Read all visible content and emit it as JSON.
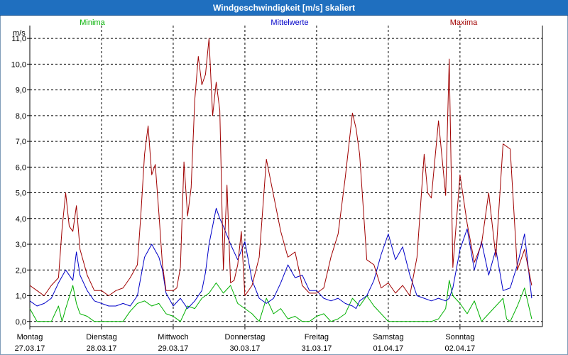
{
  "window": {
    "title": "Windgeschwindigkeit [m/s] skaliert"
  },
  "chart_data": {
    "type": "line",
    "title": "Windgeschwindigkeit [m/s] skaliert",
    "ylabel": "m/s",
    "ylim": [
      -0.2,
      11.5
    ],
    "xlim": [
      0,
      7.15
    ],
    "grid": true,
    "legend_placement": "top",
    "yticks": [
      {
        "value": 0,
        "label": "0,0"
      },
      {
        "value": 1,
        "label": "1,0"
      },
      {
        "value": 2,
        "label": "2,0"
      },
      {
        "value": 3,
        "label": "3,0"
      },
      {
        "value": 4,
        "label": "4,0"
      },
      {
        "value": 5,
        "label": "5,0"
      },
      {
        "value": 6,
        "label": "6,0"
      },
      {
        "value": 7,
        "label": "7,0"
      },
      {
        "value": 8,
        "label": "8,0"
      },
      {
        "value": 9,
        "label": "9,0"
      },
      {
        "value": 10,
        "label": "10,0"
      },
      {
        "value": 11,
        "label": "11,0"
      }
    ],
    "xticks": [
      {
        "value": 0,
        "day": "Montag",
        "date": "27.03.17"
      },
      {
        "value": 1,
        "day": "Dienstag",
        "date": "28.03.17"
      },
      {
        "value": 2,
        "day": "Mittwoch",
        "date": "29.03.17"
      },
      {
        "value": 3,
        "day": "Donnerstag",
        "date": "30.03.17"
      },
      {
        "value": 4,
        "day": "Freitag",
        "date": "31.03.17"
      },
      {
        "value": 5,
        "day": "Samstag",
        "date": "01.04.17"
      },
      {
        "value": 6,
        "day": "Sonntag",
        "date": "02.04.17"
      }
    ],
    "series": [
      {
        "name": "Minima",
        "color": "#00b000",
        "x": [
          0,
          0.1,
          0.2,
          0.3,
          0.4,
          0.45,
          0.5,
          0.6,
          0.65,
          0.7,
          0.8,
          0.9,
          1.0,
          1.1,
          1.2,
          1.3,
          1.4,
          1.5,
          1.6,
          1.7,
          1.8,
          1.9,
          2.0,
          2.1,
          2.2,
          2.3,
          2.4,
          2.5,
          2.6,
          2.7,
          2.8,
          2.9,
          3.0,
          3.1,
          3.2,
          3.3,
          3.4,
          3.5,
          3.6,
          3.7,
          3.8,
          3.9,
          4.0,
          4.1,
          4.2,
          4.3,
          4.4,
          4.5,
          4.6,
          4.7,
          4.8,
          4.9,
          5.0,
          5.1,
          5.2,
          5.3,
          5.4,
          5.5,
          5.6,
          5.7,
          5.8,
          5.85,
          5.9,
          6.0,
          6.1,
          6.2,
          6.3,
          6.4,
          6.5,
          6.6,
          6.65,
          6.7,
          6.8,
          6.9,
          7.0
        ],
        "values": [
          0.5,
          0,
          0,
          0,
          0.6,
          0,
          0.5,
          1.4,
          0.7,
          0.3,
          0.2,
          0,
          0,
          0,
          0,
          0,
          0.4,
          0.7,
          0.8,
          0.6,
          0.7,
          0.3,
          0.2,
          0,
          0.6,
          0.5,
          0.9,
          1.1,
          1.5,
          1.1,
          1.4,
          0.7,
          0.5,
          0.3,
          0,
          0.9,
          0.3,
          0.5,
          0.1,
          0.2,
          0,
          0,
          0.2,
          0.3,
          0,
          0.1,
          0.3,
          0.9,
          0.6,
          1.0,
          0.6,
          0.3,
          0,
          0,
          0,
          0,
          0,
          0,
          0,
          0.1,
          0.5,
          1.6,
          1.0,
          0.7,
          0.3,
          0.8,
          0,
          0.3,
          0.6,
          0.9,
          0.1,
          0,
          0.6,
          1.3,
          0.1
        ]
      },
      {
        "name": "Mittelwerte",
        "color": "#0000c8",
        "x": [
          0,
          0.1,
          0.2,
          0.3,
          0.4,
          0.5,
          0.6,
          0.65,
          0.7,
          0.8,
          0.9,
          1.0,
          1.1,
          1.2,
          1.3,
          1.4,
          1.5,
          1.6,
          1.7,
          1.8,
          1.85,
          1.9,
          2.0,
          2.1,
          2.2,
          2.3,
          2.4,
          2.45,
          2.5,
          2.6,
          2.65,
          2.7,
          2.8,
          2.9,
          3.0,
          3.1,
          3.2,
          3.3,
          3.4,
          3.5,
          3.6,
          3.7,
          3.8,
          3.9,
          4.0,
          4.1,
          4.2,
          4.3,
          4.4,
          4.5,
          4.55,
          4.6,
          4.7,
          4.8,
          4.9,
          5.0,
          5.1,
          5.2,
          5.3,
          5.4,
          5.5,
          5.6,
          5.7,
          5.8,
          5.85,
          5.9,
          6.0,
          6.1,
          6.2,
          6.3,
          6.4,
          6.5,
          6.6,
          6.7,
          6.8,
          6.9,
          7.0
        ],
        "values": [
          0.8,
          0.6,
          0.7,
          0.9,
          1.5,
          2.0,
          1.6,
          2.7,
          1.8,
          1.2,
          0.8,
          0.7,
          0.6,
          0.6,
          0.7,
          0.6,
          1.0,
          2.5,
          3.0,
          2.5,
          2.0,
          1.1,
          0.6,
          0.9,
          0.5,
          0.8,
          1.2,
          1.9,
          3.0,
          4.4,
          4.0,
          3.7,
          3.0,
          2.4,
          3.1,
          1.6,
          0.9,
          0.7,
          0.9,
          1.5,
          2.2,
          1.7,
          1.8,
          1.2,
          1.2,
          0.9,
          0.8,
          0.9,
          0.7,
          0.6,
          0.5,
          0.8,
          1.0,
          1.6,
          2.6,
          3.4,
          2.4,
          2.9,
          1.8,
          1.0,
          0.9,
          0.8,
          0.9,
          0.8,
          0.9,
          1.3,
          2.8,
          3.6,
          2.0,
          3.1,
          1.8,
          2.8,
          1.2,
          1.3,
          2.2,
          3.4,
          0.9
        ]
      },
      {
        "name": "Maxima",
        "color": "#a00000",
        "x": [
          0,
          0.1,
          0.2,
          0.3,
          0.4,
          0.45,
          0.5,
          0.55,
          0.6,
          0.65,
          0.7,
          0.8,
          0.9,
          1.0,
          1.1,
          1.2,
          1.3,
          1.4,
          1.5,
          1.55,
          1.6,
          1.65,
          1.7,
          1.75,
          1.8,
          1.85,
          1.9,
          2.0,
          2.05,
          2.1,
          2.15,
          2.2,
          2.25,
          2.3,
          2.35,
          2.4,
          2.45,
          2.5,
          2.55,
          2.6,
          2.65,
          2.7,
          2.75,
          2.8,
          2.85,
          2.9,
          2.95,
          3.0,
          3.1,
          3.2,
          3.3,
          3.4,
          3.5,
          3.6,
          3.7,
          3.8,
          3.9,
          4.0,
          4.1,
          4.2,
          4.3,
          4.4,
          4.5,
          4.55,
          4.6,
          4.7,
          4.8,
          4.9,
          5.0,
          5.1,
          5.2,
          5.3,
          5.4,
          5.5,
          5.55,
          5.6,
          5.7,
          5.8,
          5.85,
          5.9,
          6.0,
          6.1,
          6.2,
          6.3,
          6.4,
          6.5,
          6.6,
          6.7,
          6.8,
          6.9,
          7.0
        ],
        "values": [
          1.4,
          1.2,
          1.0,
          1.4,
          1.7,
          3.6,
          5.0,
          3.7,
          3.5,
          4.5,
          2.8,
          1.8,
          1.2,
          1.2,
          1.0,
          1.2,
          1.3,
          1.7,
          2.2,
          4.2,
          6.5,
          7.6,
          5.7,
          6.1,
          4.2,
          2.2,
          1.2,
          1.2,
          1.3,
          2.1,
          6.2,
          4.1,
          5.2,
          8.6,
          10.3,
          9.2,
          9.6,
          11.0,
          8.0,
          9.3,
          8.2,
          2.0,
          5.3,
          1.5,
          1.6,
          2.2,
          3.5,
          1.0,
          1.4,
          2.5,
          6.3,
          4.9,
          3.5,
          2.5,
          2.7,
          1.4,
          1.1,
          1.1,
          1.3,
          2.5,
          3.4,
          5.6,
          8.1,
          7.5,
          6.5,
          2.4,
          2.2,
          1.3,
          1.5,
          1.1,
          1.4,
          1.0,
          2.5,
          6.5,
          5.0,
          4.8,
          7.8,
          4.9,
          10.2,
          2.1,
          5.7,
          3.8,
          2.3,
          3.0,
          5.0,
          2.5,
          6.9,
          6.7,
          2.0,
          2.8,
          1.4
        ]
      }
    ]
  }
}
